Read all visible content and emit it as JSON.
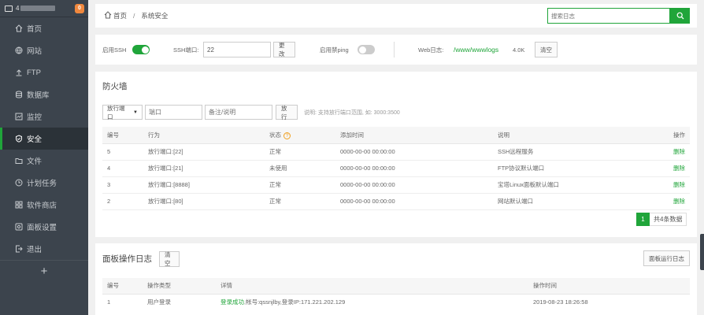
{
  "sidebar": {
    "host_prefix": "4",
    "badge": "0",
    "items": [
      {
        "label": "首页",
        "icon": "home-icon"
      },
      {
        "label": "网站",
        "icon": "globe-icon"
      },
      {
        "label": "FTP",
        "icon": "upload-icon"
      },
      {
        "label": "数据库",
        "icon": "database-icon"
      },
      {
        "label": "监控",
        "icon": "monitor-icon"
      },
      {
        "label": "安全",
        "icon": "shield-icon",
        "active": true
      },
      {
        "label": "文件",
        "icon": "folder-icon"
      },
      {
        "label": "计划任务",
        "icon": "clock-icon"
      },
      {
        "label": "软件商店",
        "icon": "grid-icon"
      },
      {
        "label": "面板设置",
        "icon": "settings-icon"
      },
      {
        "label": "退出",
        "icon": "logout-icon"
      }
    ],
    "add": "+"
  },
  "breadcrumb": {
    "home": "首页",
    "sep": "/",
    "current": "系统安全"
  },
  "search": {
    "placeholder": "搜索日志"
  },
  "settings": {
    "ssh_label": "启用SSH",
    "ssh_on": true,
    "port_label": "SSH端口:",
    "port_value": "22",
    "change_btn": "更改",
    "ping_label": "启用禁ping",
    "ping_on": false,
    "weblog_label": "Web日志:",
    "weblog_path": "/www/wwwlogs",
    "weblog_size": "4.0K",
    "clear_btn": "清空"
  },
  "firewall": {
    "title": "防火墙",
    "select_value": "放行端口",
    "port_placeholder": "端口",
    "note_placeholder": "备注/说明",
    "allow_btn": "放行",
    "hint": "说明: 支持放行端口范围, 如: 3000:3500",
    "headers": [
      "编号",
      "行为",
      "状态",
      "添加时间",
      "说明",
      "操作"
    ],
    "rows": [
      {
        "id": "5",
        "action": "放行端口:[22]",
        "status": "正常",
        "time": "0000-00-00 00:00:00",
        "desc": "SSH远程服务",
        "op": "删除"
      },
      {
        "id": "4",
        "action": "放行端口:[21]",
        "status": "未使用",
        "time": "0000-00-00 00:00:00",
        "desc": "FTP协议默认端口",
        "op": "删除"
      },
      {
        "id": "3",
        "action": "放行端口:[8888]",
        "status": "正常",
        "time": "0000-00-00 00:00:00",
        "desc": "宝塔Linux面板默认端口",
        "op": "删除"
      },
      {
        "id": "2",
        "action": "放行端口:[80]",
        "status": "正常",
        "time": "0000-00-00 00:00:00",
        "desc": "网站默认端口",
        "op": "删除"
      }
    ],
    "page": "1",
    "total": "共4条数据"
  },
  "oplog": {
    "title": "面板操作日志",
    "clear_btn": "清空",
    "runlog_btn": "面板运行日志",
    "headers": [
      "编号",
      "操作类型",
      "详情",
      "操作时间"
    ],
    "rows": [
      {
        "id": "1",
        "type": "用户登录",
        "detail_ok": "登录成功",
        "detail_rest": ",帐号:qssnjlby,登录IP:171.221.202.129",
        "time": "2019-08-23 18:26:58"
      }
    ]
  }
}
